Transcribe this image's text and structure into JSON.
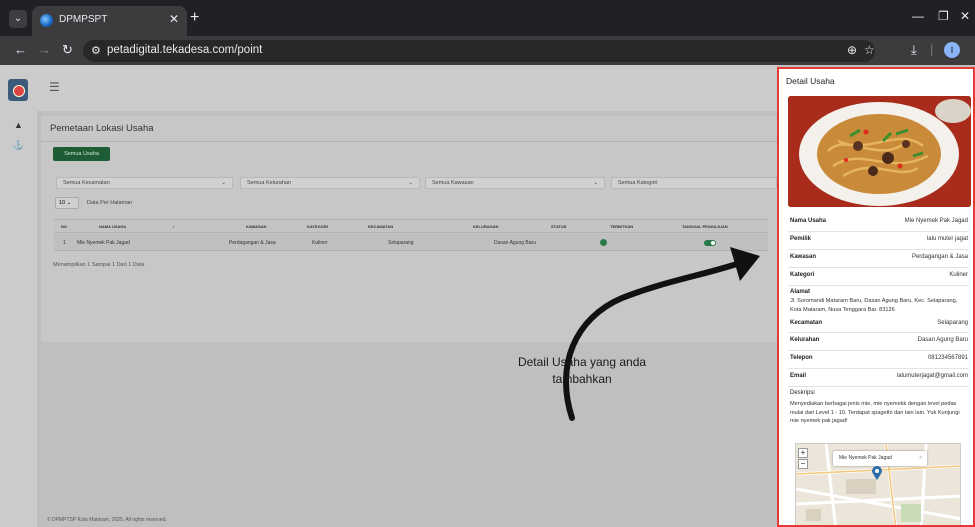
{
  "browser": {
    "tab_title": "DPMPSPT",
    "url": "petadigital.tekadesa.com/point",
    "profile_initial": "I"
  },
  "app": {
    "page_heading": "Pemetaan Lokasi Usaha",
    "all_business_button": "Semua Usaha",
    "filters": {
      "kecamatan": "Semua Kecamatan",
      "kelurahan": "Semua Kelurahan",
      "kawasan": "Semua Kawasan",
      "kategori": "Semua Kategori"
    },
    "per_page_value": "10",
    "per_page_label": "Data Per Halaman",
    "table": {
      "headers": [
        "NO",
        "NAMA USAHA",
        "KAWASAN",
        "KATEGORI",
        "KECAMATAN",
        "KELURAHAN",
        "STATUS",
        "TERBITKAN",
        "TANGGAL PENGAJUAN"
      ],
      "rows": [
        {
          "no": "1",
          "nama_usaha": "Mie Nyemek Pak Jagad",
          "kawasan": "Perdagangan & Jasa",
          "kategori": "Kuliner",
          "kecamatan": "Selaparang",
          "kelurahan": "Dasan Agung Baru"
        }
      ]
    },
    "summary": "Menampilkan 1 Sampai 1 Dari 1 Data",
    "footer": "© DPMPTSP Kota Mataram, 2025. All rights reserved."
  },
  "annotation": {
    "line1": "Detail Usaha yang anda",
    "line2": "tambahkan"
  },
  "detail": {
    "title": "Detail Usaha",
    "fields": [
      {
        "label": "Nama Usaha",
        "value": "Mie Nyemek Pak Jagad"
      },
      {
        "label": "Pemilik",
        "value": "lalu muter jagat"
      },
      {
        "label": "Kawasan",
        "value": "Perdagangan & Jasa"
      },
      {
        "label": "Kategori",
        "value": "Kuliner"
      }
    ],
    "alamat_label": "Alamat",
    "alamat_value": "Jl. Soromandi Mataram Baru, Dasan Agung Baru, Kec. Selaparang, Kota Mataram, Nusa Tenggara Bar. 83126",
    "fields2": [
      {
        "label": "Kecamatan",
        "value": "Selaparang"
      },
      {
        "label": "Kelurahan",
        "value": "Dasan Agung Baru"
      },
      {
        "label": "Telepon",
        "value": "081234567891"
      },
      {
        "label": "Email",
        "value": "lalumuterjagat@gmail.com"
      }
    ],
    "deskripsi_label": "Deskripsi",
    "deskripsi_value": "Menyediakan berbagai jenis mie, mie nyemekk dengan level pedas mulai dari Level 1 - 10. Terdapat spagethi dan lain lain. Yuk Kunjungi mie nyemek pak jagad!",
    "map_popup": "Mie Nyemek Pak Jagad"
  },
  "colors": {
    "accent_green": "#1d5c34",
    "highlight_red": "#e53935"
  }
}
